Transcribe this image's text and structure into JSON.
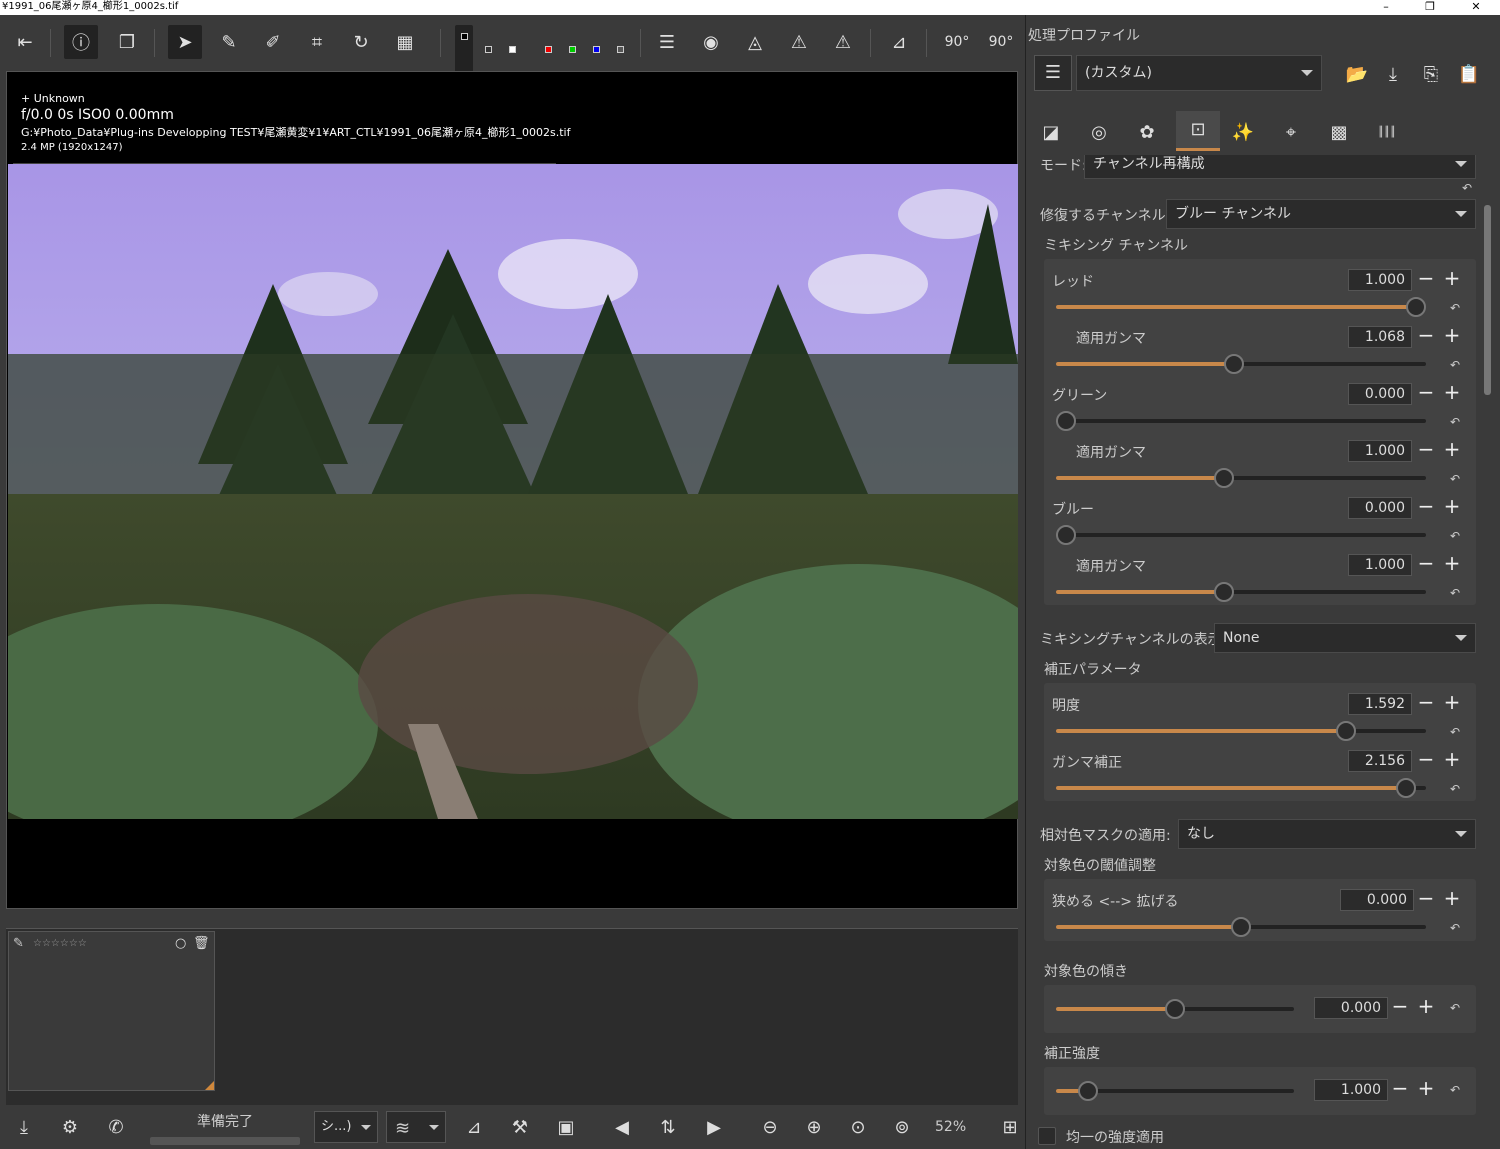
{
  "window": {
    "title": "¥1991_06尾瀬ヶ原4_櫛形1_0002s.tif"
  },
  "toolbar": {
    "buttons": [
      "exit-fullscreen-icon",
      "info-icon",
      "before-after-icon",
      "hand-icon",
      "color-picker-icon",
      "wb-picker-icon",
      "crop-icon",
      "straighten-icon",
      "perspective-icon"
    ],
    "channels": [
      "R",
      "G",
      "B"
    ],
    "right_buttons": [
      "histogram-icon",
      "focus-mask-icon",
      "clip-shadow-icon",
      "warning-highlight-icon",
      "warning-shadow-icon",
      "vertical-rotate-icon",
      "rotate-left-icon",
      "rotate-right-icon"
    ],
    "rotate_left_label": "90°",
    "rotate_right_label": "90°"
  },
  "image_info": {
    "line1": "+ Unknown",
    "line2": "f/0.0  0s  ISO0  0.00mm",
    "path": "G:¥Photo_Data¥Plug-ins Developping TEST¥尾瀬黄変¥1¥ART_CTL¥1991_06尾瀬ヶ原4_櫛形1_0002s.tif",
    "size": "2.4 MP (1920x1247)"
  },
  "filmstrip": {
    "stars": "☆☆☆☆☆☆"
  },
  "bottombar": {
    "status": "準備完了",
    "mode": "シ...)",
    "zoom": "52%"
  },
  "panel": {
    "profile_title": "処理プロファイル",
    "profile_value": "(カスタム)",
    "mode_label": "モード:",
    "mode_value": "チャンネル再構成",
    "repair_label": "修復するチャンネル:",
    "repair_value": "ブルー チャンネル",
    "mixing_title": "ミキシング チャンネル",
    "mixing": [
      {
        "name": "レッド",
        "value": "1.000",
        "ratio": 1.0
      },
      {
        "name": "適用ガンマ",
        "value": "1.068",
        "ratio": 0.48
      },
      {
        "name": "グリーン",
        "value": "0.000",
        "ratio": 0.0
      },
      {
        "name": "適用ガンマ",
        "value": "1.000",
        "ratio": 0.45
      },
      {
        "name": "ブルー",
        "value": "0.000",
        "ratio": 0.0
      },
      {
        "name": "適用ガンマ",
        "value": "1.000",
        "ratio": 0.45
      }
    ],
    "display_label": "ミキシングチャンネルの表示:",
    "display_value": "None",
    "correction_title": "補正パラメータ",
    "correction": [
      {
        "name": "明度",
        "value": "1.592",
        "ratio": 0.8
      },
      {
        "name": "ガンマ補正",
        "value": "2.156",
        "ratio": 0.97
      }
    ],
    "mask_label": "相対色マスクの適用:",
    "mask_value": "なし",
    "threshold_title": "対象色の閾値調整",
    "threshold": {
      "name": "狭める <--> 拡げる",
      "value": "0.000",
      "ratio": 0.5
    },
    "slope_title": "対象色の傾き",
    "slope": {
      "value": "0.000",
      "ratio": 0.5
    },
    "strength_title": "補正強度",
    "strength": {
      "value": "1.000",
      "ratio": 0.1
    },
    "uniform_label": "均一の強度適用"
  },
  "colors": {
    "accent": "#c8884a",
    "sky": "#b9a9ec"
  }
}
